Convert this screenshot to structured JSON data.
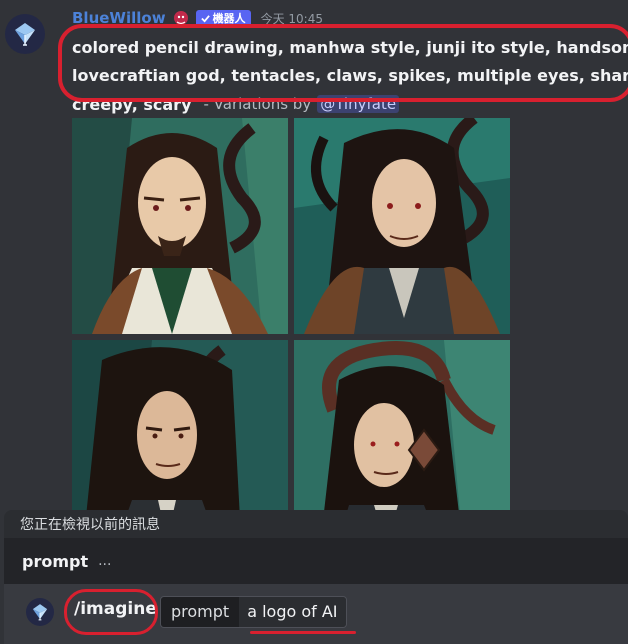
{
  "message": {
    "username": "BlueWillow",
    "bot_tag": "機器人",
    "timestamp": "今天 10:45",
    "prompt_line1": "colored pencil drawing, manhwa style, junji ito style, handsome",
    "prompt_line2": "lovecraftian god, tentacles, claws, spikes, multiple eyes, sharp",
    "prompt_line3_bold": "creepy, scary",
    "variations_text": "- Variations by",
    "mention": "@Tinyfate"
  },
  "history_notice": "您正在檢視以前的訊息",
  "option_bar": {
    "option_name": "prompt",
    "ellipsis": "..."
  },
  "composer": {
    "command": "/imagine",
    "param_name": "prompt",
    "param_value": "a logo of AI"
  },
  "colors": {
    "background": "#313338",
    "username": "#4c82d8",
    "bot_tag": "#5865f2",
    "annotation_red": "#d8202f",
    "mention_bg": "#3c4270"
  }
}
